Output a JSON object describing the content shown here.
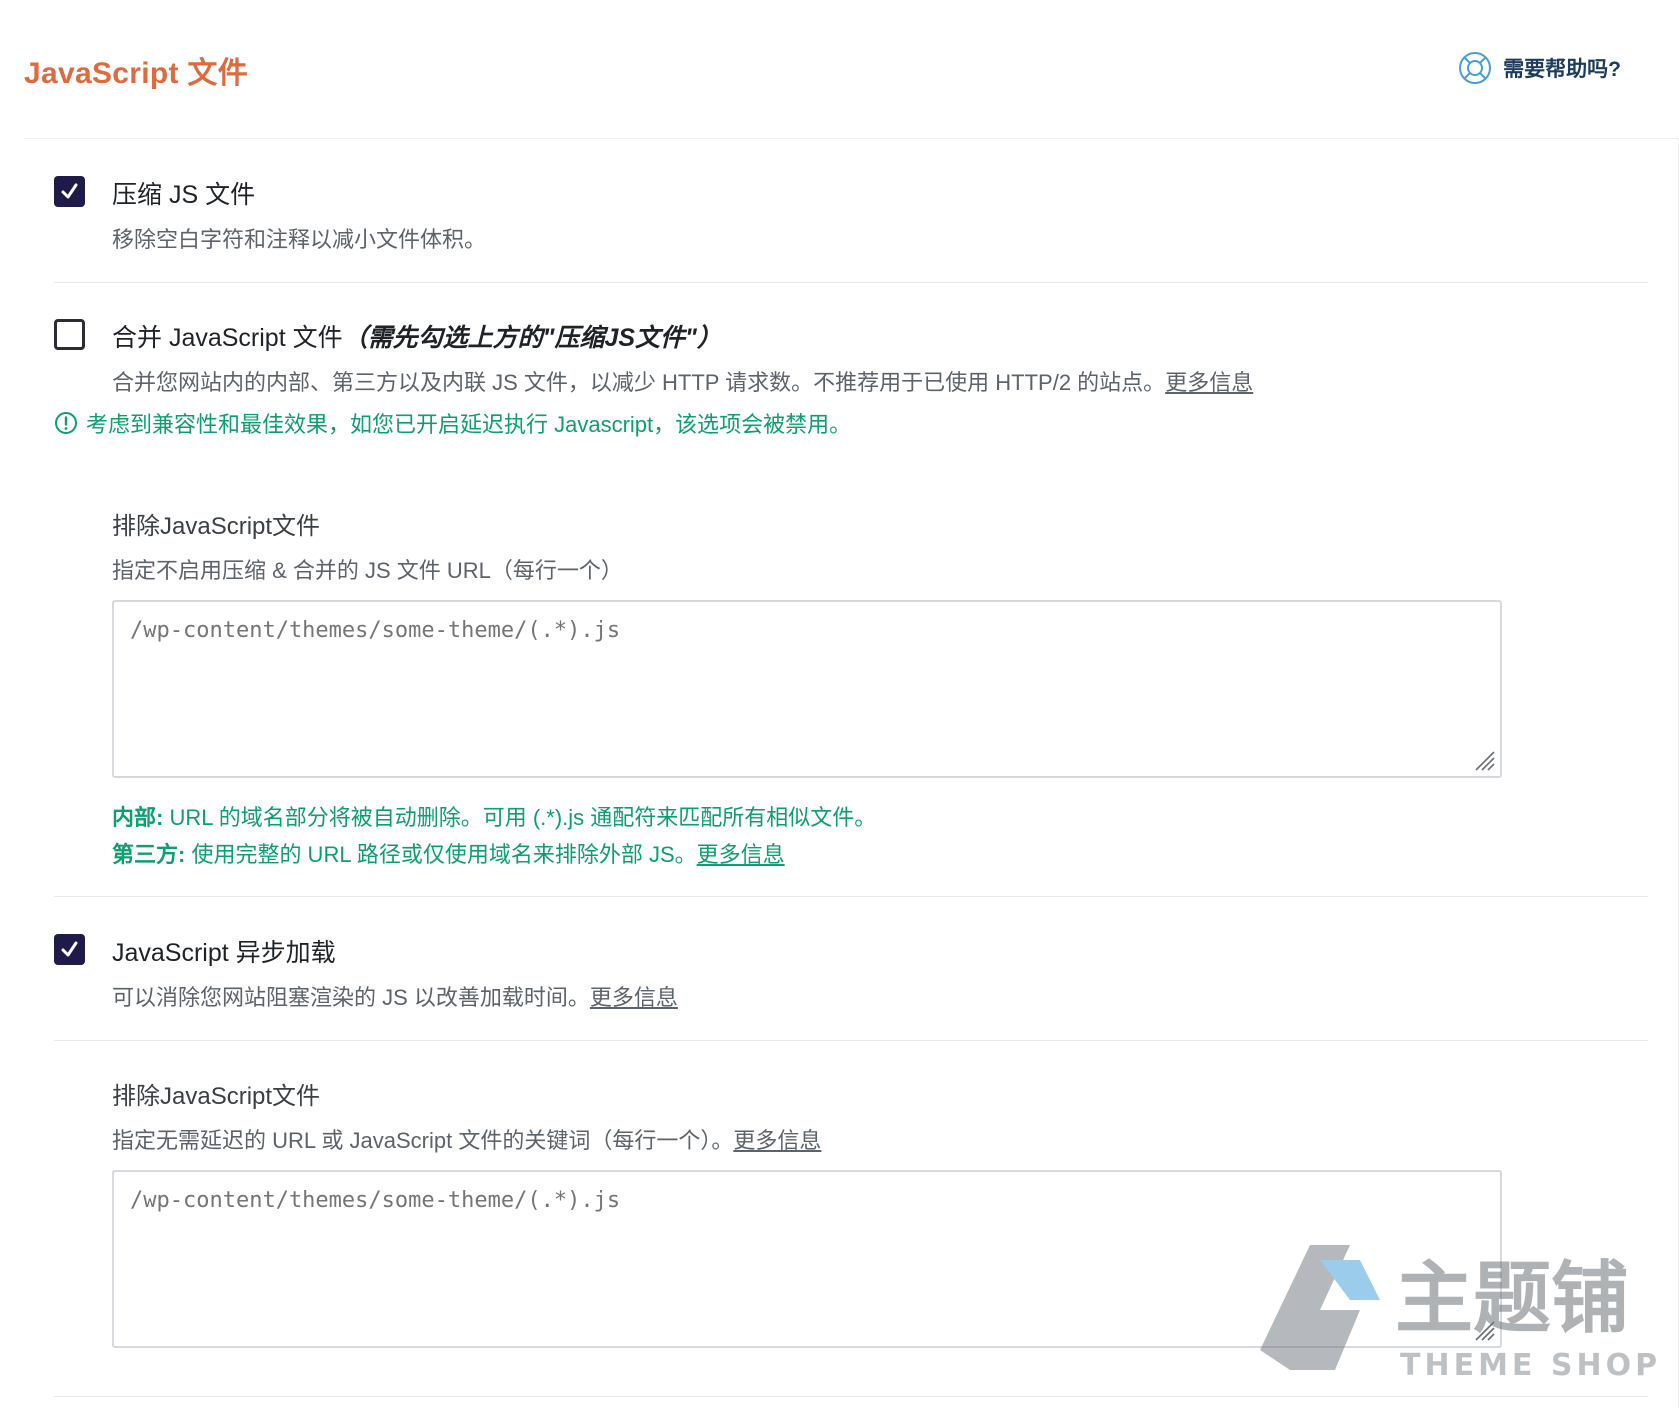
{
  "header": {
    "title": "JavaScript 文件",
    "help_label": "需要帮助吗?"
  },
  "minify": {
    "checked": true,
    "label": "压缩 JS 文件",
    "description": "移除空白字符和注释以减小文件体积。"
  },
  "combine": {
    "checked": false,
    "label": "合并 JavaScript 文件",
    "label_note": "（需先勾选上方的\"压缩JS文件\"）",
    "description": "合并您网站内的内部、第三方以及内联 JS 文件，以减少 HTTP 请求数。不推荐用于已使用 HTTP/2 的站点。",
    "more_link": "更多信息",
    "warning": "考虑到兼容性和最佳效果，如您已开启延迟执行 Javascript，该选项会被禁用。"
  },
  "exclude_minify": {
    "title": "排除JavaScript文件",
    "description": "指定不启用压缩 & 合并的 JS 文件 URL（每行一个）",
    "placeholder": "/wp-content/themes/some-theme/(.*).js",
    "note_internal_label": "内部:",
    "note_internal_text": " URL 的域名部分将被自动删除。可用 (.*).js 通配符来匹配所有相似文件。",
    "note_third_label": "第三方:",
    "note_third_text": " 使用完整的 URL 路径或仅使用域名来排除外部 JS。",
    "note_more_link": "更多信息"
  },
  "defer": {
    "checked": true,
    "label": "JavaScript 异步加载",
    "description": "可以消除您网站阻塞渲染的 JS 以改善加载时间。",
    "more_link": "更多信息"
  },
  "exclude_defer": {
    "title": "排除JavaScript文件",
    "description": "指定无需延迟的 URL 或 JavaScript 文件的关键词（每行一个）。",
    "more_link": "更多信息",
    "placeholder": "/wp-content/themes/some-theme/(.*).js"
  },
  "watermark": {
    "brand": "主题铺",
    "sub": "THEME SHOP"
  },
  "colors": {
    "accent": "#e06a3f",
    "checkbox": "#1f1b49",
    "success": "#0e9f6e",
    "help": "#1d3d5e"
  }
}
